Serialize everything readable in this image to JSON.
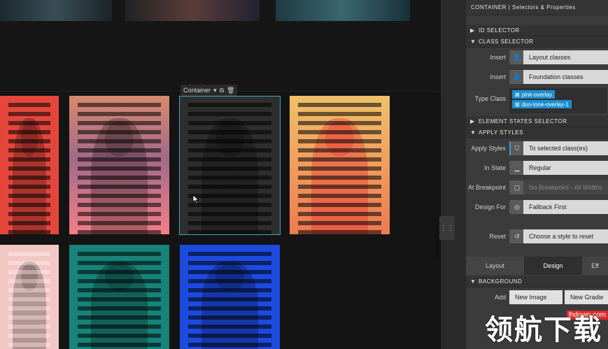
{
  "canvas": {
    "container_tag": "Container",
    "photos": [
      {
        "name": "red",
        "color": "#e5463b"
      },
      {
        "name": "pink-overlay",
        "color": "#e8836a"
      },
      {
        "name": "selected-dark",
        "color": "#2e2e2e"
      },
      {
        "name": "orange",
        "color": "#f0a05e"
      },
      {
        "name": "light-pink",
        "color": "#f2c7c4"
      },
      {
        "name": "teal",
        "color": "#18837a"
      },
      {
        "name": "blue",
        "color": "#1c4be0"
      }
    ]
  },
  "panel": {
    "title": "CONTAINER | Selectors & Properties",
    "sections": {
      "id_selector": "ID SELECTOR",
      "class_selector": "CLASS SELECTOR",
      "element_states": "ELEMENT STATES SELECTOR",
      "apply_styles": "APPLY STYLES",
      "background": "BACKGROUND"
    },
    "insert1": {
      "label": "Insert",
      "value": "Layout classes"
    },
    "insert2": {
      "label": "Insert",
      "value": "Foundation classes"
    },
    "type_class": {
      "label": "Type Class",
      "chips": [
        "pink-overlay",
        "duo-tone-overlay-1"
      ]
    },
    "apply_styles": {
      "label": "Apply Styles",
      "value": "To selected class(es)"
    },
    "in_state": {
      "label": "In State",
      "value": "Regular"
    },
    "at_breakpoint": {
      "label": "At Breakpoint",
      "value": "No Breakpoint - All Widths"
    },
    "design_for": {
      "label": "Design For",
      "value": "Fallback First"
    },
    "reset": {
      "label": "Reset",
      "value": "Choose a style to reset"
    },
    "tabs": [
      "Layout",
      "Design",
      "Eff"
    ],
    "add": {
      "label": "Add",
      "new_image": "New Image",
      "new_gradient": "New Gradie"
    }
  },
  "watermark": {
    "text": "领航下载",
    "badge": "lhdown.com"
  },
  "colors": {
    "accent": "#1d8fd1",
    "selection": "#3aa6c9"
  }
}
